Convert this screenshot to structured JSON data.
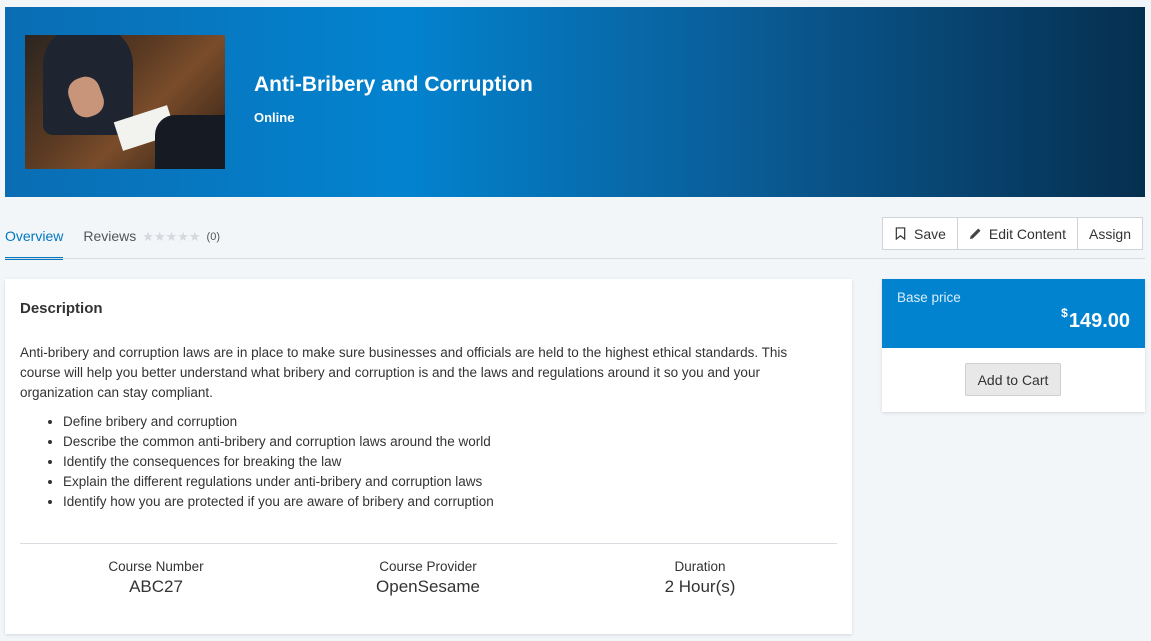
{
  "course": {
    "title": "Anti-Bribery and Corruption",
    "format": "Online"
  },
  "tabs": {
    "overview": "Overview",
    "reviews": "Reviews",
    "stars": "★★★★★",
    "review_count": "(0)",
    "rating": 0
  },
  "actions": {
    "save": "Save",
    "edit": "Edit Content",
    "assign": "Assign"
  },
  "description": {
    "heading": "Description",
    "text": "Anti-bribery and corruption laws are in place to make sure businesses and officials are held to the highest ethical standards. This course will help you better understand what bribery and corruption is and the laws and regulations around it so you and your organization can stay compliant.",
    "objectives": [
      "Define bribery and corruption",
      "Describe the common anti-bribery and corruption laws around the world",
      "Identify the consequences for breaking the law",
      "Explain the different regulations under anti-bribery and corruption laws",
      "Identify how you are protected if you are aware of bribery and corruption"
    ]
  },
  "meta": {
    "number_label": "Course Number",
    "number_value": "ABC27",
    "provider_label": "Course Provider",
    "provider_value": "OpenSesame",
    "duration_label": "Duration",
    "duration_value": "2 Hour(s)"
  },
  "price": {
    "label": "Base price",
    "currency": "$",
    "amount": "149.00",
    "cart_label": "Add to Cart"
  },
  "colors": {
    "accent": "#0277c2",
    "price_header": "#0283d0"
  }
}
